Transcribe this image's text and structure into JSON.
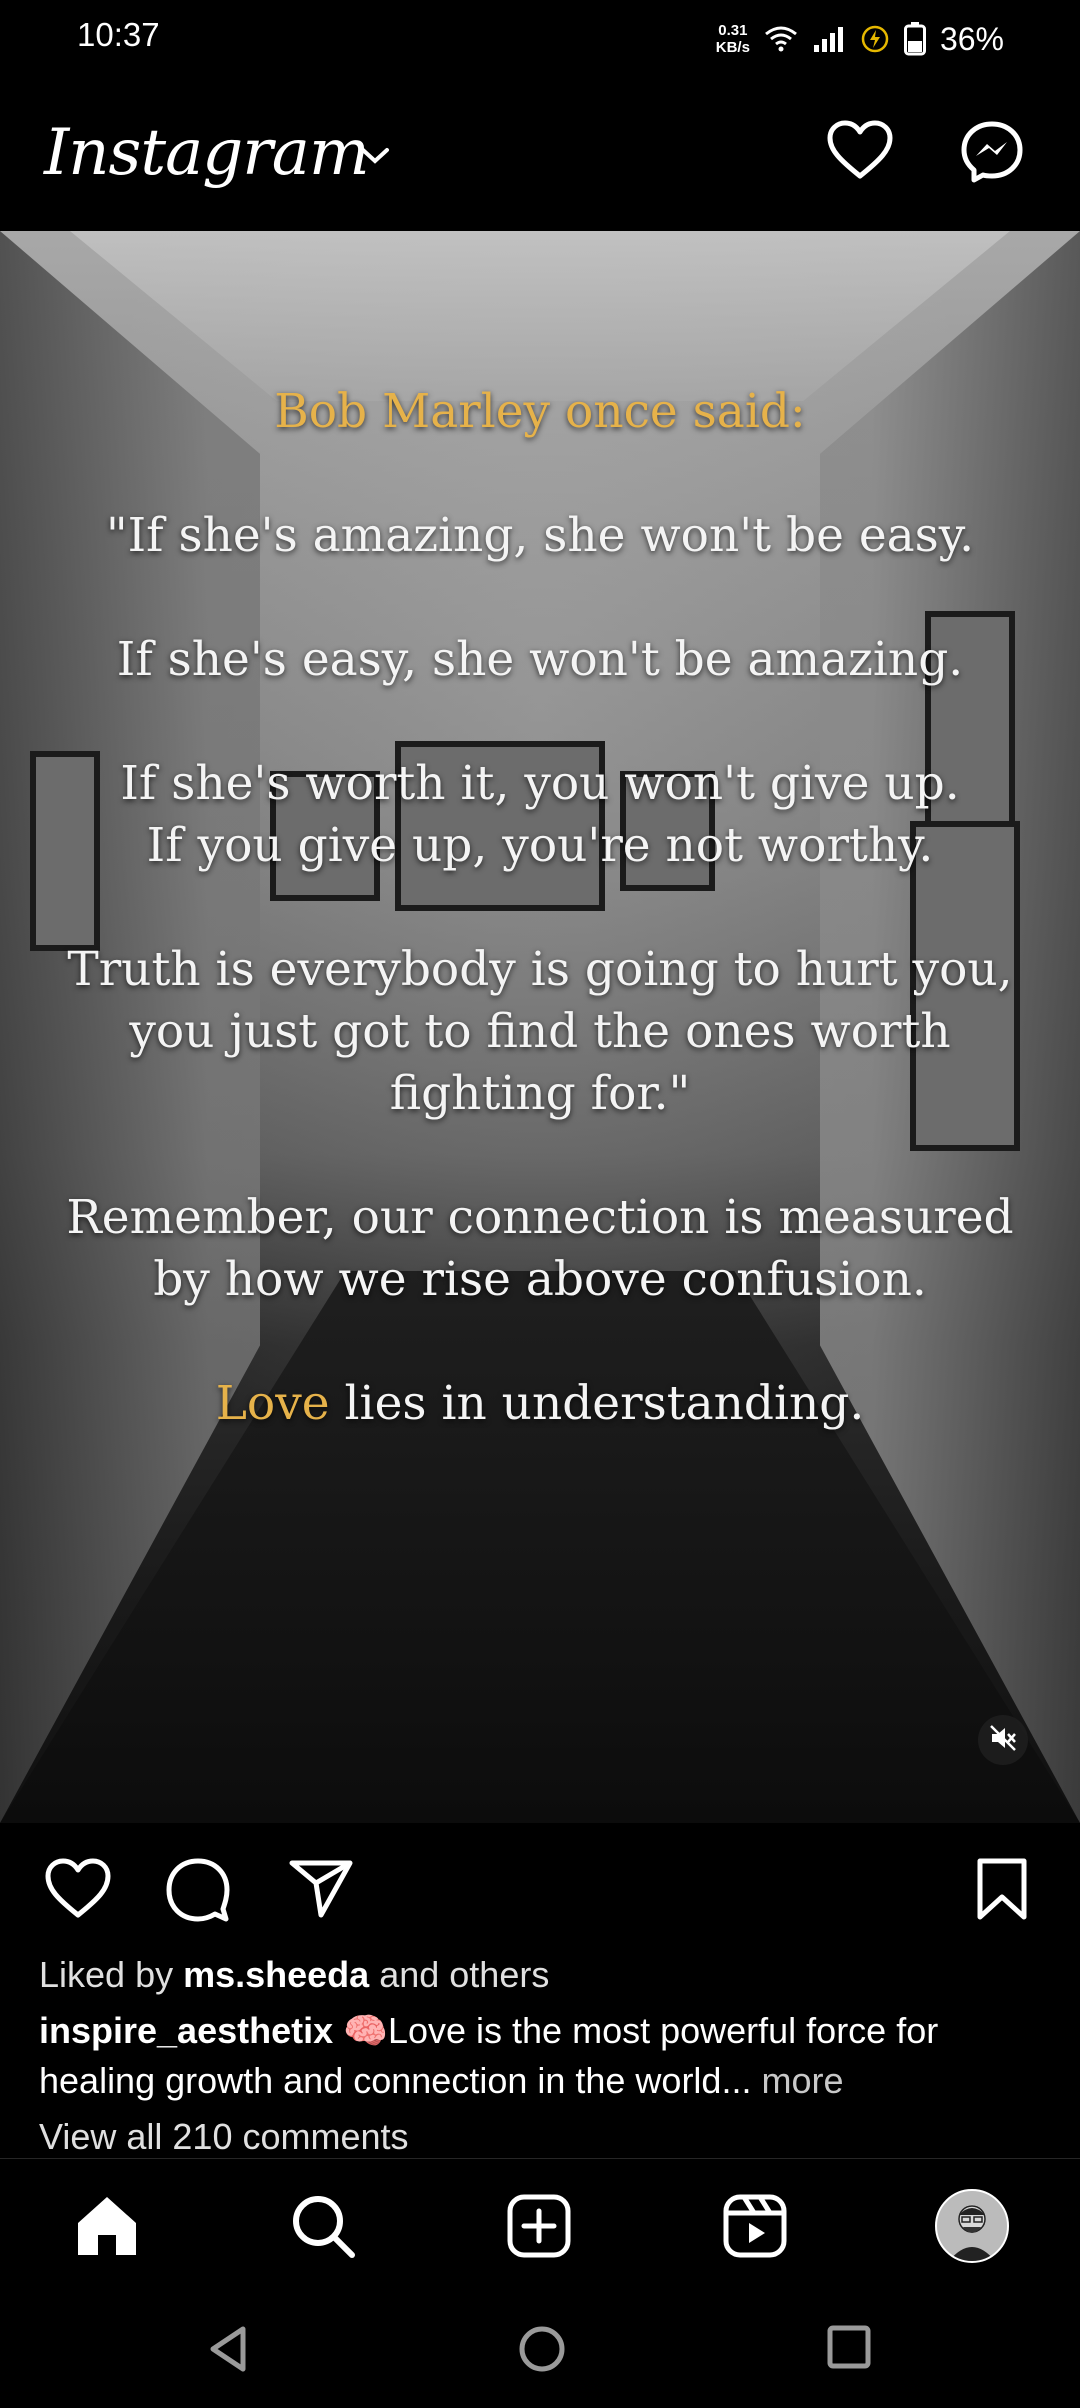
{
  "status_bar": {
    "time": "10:37",
    "net_speed_value": "0.31",
    "net_speed_unit": "KB/s",
    "battery_pct": "36%"
  },
  "app_bar": {
    "brand": "Instagram"
  },
  "post": {
    "quote_title": "Bob Marley once said:",
    "paragraphs": [
      "\"If she's amazing, she won't be easy.",
      "If she's easy, she won't be amazing.",
      "If she's worth it, you won't give up.\nIf you give up, you're not worthy.",
      "Truth is everybody is going to hurt you, you just got to find the ones worth fighting for.\"",
      "Remember, our connection is measured by how we rise above confusion."
    ],
    "closing_highlight": "Love",
    "closing_rest": " lies in understanding."
  },
  "engagement": {
    "liked_prefix": "Liked by ",
    "liked_user": "ms.sheeda",
    "liked_suffix": " and others",
    "author": "inspire_aesthetix",
    "caption": " 🧠Love is the most powerful force for healing growth and connection in the world...",
    "more": " more",
    "view_comments": "View all 210 comments"
  },
  "colors": {
    "accent_gold": "#e6b24a",
    "background": "#000000"
  }
}
